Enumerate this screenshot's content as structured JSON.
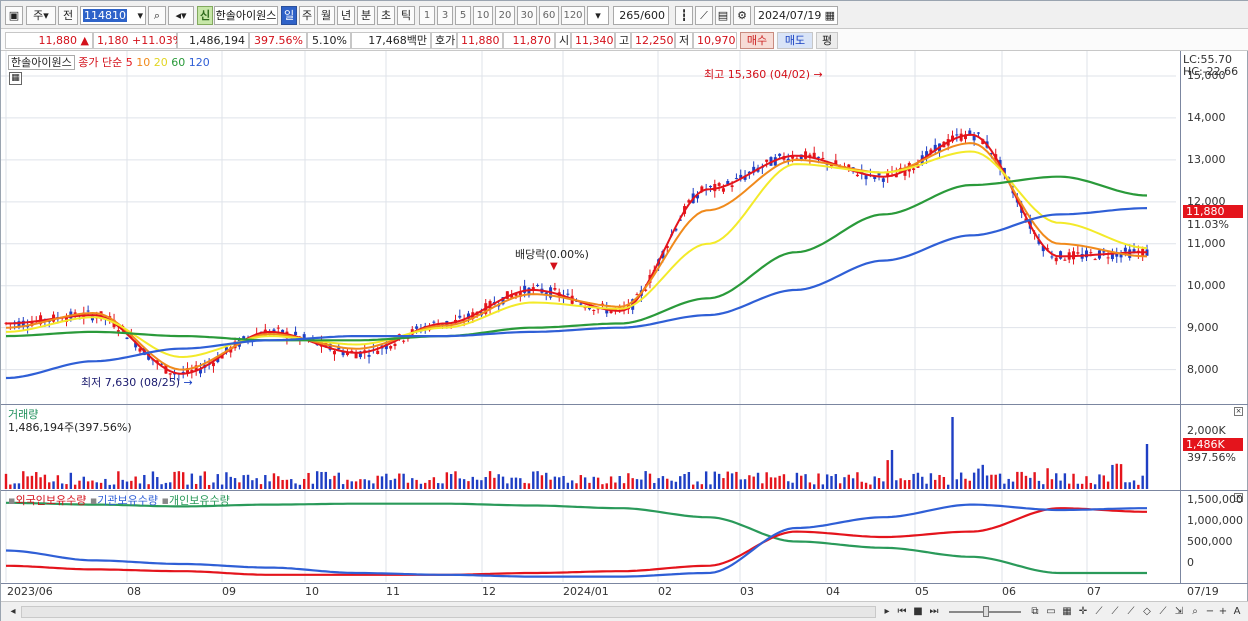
{
  "toolbar": {
    "period": "주",
    "prev": "전",
    "code": "114810",
    "shin": "신",
    "stock_name": "한솔아이원스",
    "timeframes": [
      "일",
      "주",
      "월",
      "년",
      "분",
      "초",
      "틱"
    ],
    "selected_timeframe": "일",
    "intervals": [
      "1",
      "3",
      "5",
      "10",
      "20",
      "30",
      "60",
      "120"
    ],
    "count": "265",
    "count_total": "/600",
    "date": "2024/07/19"
  },
  "quote": {
    "price": "11,880",
    "change": "1,180 +11.03%",
    "volume": "1,486,194",
    "volume_ratio": "397.56%",
    "turnover": "5.10%",
    "amount": "17,468백만",
    "ask_label": "호가",
    "ask": "11,880",
    "bid": "11,870",
    "open_label": "시",
    "open": "11,340",
    "high_label": "고",
    "high": "12,250",
    "low_label": "저",
    "low": "10,970",
    "buy": "매수",
    "sell": "매도",
    "eval": "평"
  },
  "price_pane": {
    "legend_name": "한솔아이원스",
    "legend_type": "종가 단순",
    "ma_periods": [
      "5",
      "10",
      "20",
      "60",
      "120"
    ],
    "lc": "LC:55.70",
    "hc": "HC:-22.66",
    "y_ticks": [
      "15,000",
      "14,000",
      "13,000",
      "12,000",
      "11,000",
      "10,000",
      "9,000",
      "8,000"
    ],
    "current_price_box": "11,880",
    "current_pct": "11.03%",
    "annotation_high": "최고 15,360 (04/02)",
    "annotation_low": "최저 7,630 (08/25)",
    "annotation_dividend": "배당락(0.00%)"
  },
  "volume_pane": {
    "title": "거래량",
    "value": "1,486,194주(397.56%)",
    "y_tick": "2,000K",
    "current_box": "1,486K",
    "current_pct": "397.56%"
  },
  "holdings_pane": {
    "legends": [
      "외국인보유수량",
      "기관보유수량",
      "개인보유수량"
    ],
    "y_ticks": [
      "1,500,000",
      "1,000,000",
      "500,000",
      "0"
    ]
  },
  "x_axis": [
    "2023/06",
    "08",
    "09",
    "10",
    "11",
    "12",
    "2024/01",
    "02",
    "03",
    "04",
    "05",
    "06",
    "07",
    "07/19"
  ],
  "colors": {
    "up": "#e4141c",
    "down": "#1f3fc4",
    "ma5": "#e4141c",
    "ma10": "#f08a1c",
    "ma20": "#f3ea2a",
    "ma60": "#2a9a3a",
    "ma120": "#2f5fd6",
    "foreign": "#e4141c",
    "institution": "#2f5fd6",
    "individual": "#2a9a5a"
  },
  "chart_data": {
    "type": "line",
    "x": [
      "2023/06",
      "08",
      "09",
      "10",
      "11",
      "12",
      "2024/01",
      "02",
      "03",
      "04",
      "05",
      "06",
      "07",
      "07/19"
    ],
    "series": [
      {
        "name": "5",
        "values": [
          9100,
          9300,
          7900,
          8900,
          8400,
          9100,
          9900,
          9400,
          12300,
          13100,
          12600,
          13600,
          10700,
          10800
        ]
      },
      {
        "name": "10",
        "values": [
          9000,
          9350,
          8000,
          8850,
          8500,
          9050,
          9800,
          9500,
          11800,
          13000,
          12700,
          13400,
          11000,
          10700
        ]
      },
      {
        "name": "20",
        "values": [
          8900,
          9250,
          8300,
          8800,
          8600,
          9000,
          9600,
          9450,
          11000,
          12900,
          12700,
          13200,
          11500,
          10900
        ]
      },
      {
        "name": "60",
        "values": [
          8800,
          8900,
          8800,
          8700,
          8700,
          8800,
          9000,
          9100,
          9700,
          10800,
          11700,
          12400,
          12600,
          12150
        ]
      },
      {
        "name": "120",
        "values": [
          7800,
          8200,
          8500,
          8700,
          8800,
          8800,
          8900,
          9000,
          9300,
          9900,
          10600,
          11200,
          11700,
          11850
        ]
      }
    ],
    "ylim": [
      7300,
      15500
    ]
  }
}
